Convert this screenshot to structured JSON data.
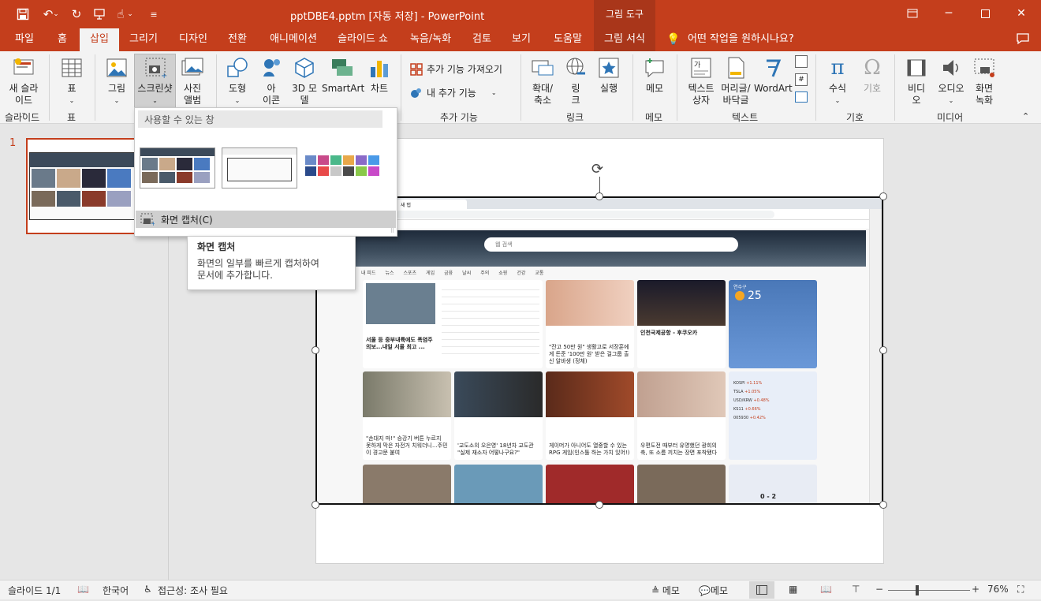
{
  "window": {
    "title": "pptDBE4.pptm [자동 저장]  -  PowerPoint",
    "picture_tools": "그림 도구"
  },
  "tabs": [
    "파일",
    "홈",
    "삽입",
    "그리기",
    "디자인",
    "전환",
    "애니메이션",
    "슬라이드 쇼",
    "녹음/녹화",
    "검토",
    "보기",
    "도움말",
    "그림 서식"
  ],
  "tell_me": "어떤 작업을 원하시나요?",
  "ribbon": {
    "new_slide": "새 슬라\n이드",
    "table": "표",
    "picture": "그림",
    "screenshot": "스크린샷",
    "album": "사진\n앨범",
    "shapes": "도형",
    "icons": "아\n이콘",
    "model3d": "3D 모\n델",
    "smartart": "SmartArt",
    "chart": "차트",
    "get_addins": "추가 기능 가져오기",
    "my_addins": "내 추가 기능",
    "zoom": "확대/\n축소",
    "link": "링\n크",
    "action": "실행",
    "comment": "메모",
    "textbox": "텍스트\n상자",
    "header_footer": "머리글/\n바닥글",
    "wordart": "WordArt",
    "equation": "수식",
    "symbol": "기호",
    "video": "비디\n오",
    "audio": "오디오",
    "screen_rec": "화면\n녹화",
    "groups": {
      "slides": "슬라이드",
      "tables": "표",
      "addins": "추가 기능",
      "links": "링크",
      "comments": "메모",
      "text": "텍스트",
      "symbols": "기호",
      "media": "미디어"
    }
  },
  "dropdown": {
    "header": "사용할 수 있는 창",
    "screen_capture": "화면 캡처(C)"
  },
  "tooltip": {
    "title": "화면 캡처",
    "body": "화면의 일부를 빠르게 캡처하여\n문서에 추가합니다."
  },
  "thumbnail_number": "1",
  "browser": {
    "tab_title": "새 탭",
    "search_placeholder": "웹 검색",
    "weather_temp": "25",
    "weather_location": "연수구",
    "nav": [
      "내 피드",
      "뉴스",
      "스포츠",
      "게임",
      "금융",
      "날씨",
      "주의",
      "쇼핑",
      "건강",
      "교통"
    ],
    "cards": [
      "서울 등 중부내륙에도 폭염주의보...내일 서울 최고 ...",
      "\"잔고 50만 원\" 생활고로 서장훈에게 돈준 '100만 원' 받은 걸그룹 출신 알바생 (정체)",
      "인천국제공항 - 후쿠오카",
      "\"손대지 마!\" 승강기 버튼 누르지 못하게 막은 자전거 치워더니...주민이 경고문 붙여",
      "'교도소의 오은영' 18년차 교도관 \"실제 재소자 어떻나구요?\"",
      "게이머가 아니어도 열중할 수 있는 RPG 게임(인스톨 하는 가치 있어!)",
      "우편도전 때부터 유명했던 광희의 축, 또 소름 끼치는 장면 포착됐다"
    ],
    "stocks": [
      {
        "name": "KOSPI",
        "change": "+1.11%"
      },
      {
        "name": "TSLA",
        "change": "+1.05%"
      },
      {
        "name": "USD/KRW",
        "change": "+0.48%"
      },
      {
        "name": "KS11",
        "change": "+0.66%"
      },
      {
        "name": "005930",
        "change": "+0.42%"
      }
    ],
    "mlb_score": "0 - 2"
  },
  "status": {
    "slide": "슬라이드 1/1",
    "lang": "한국어",
    "access": "접근성: 조사 필요",
    "notes": "메모",
    "comments": "메모",
    "zoom": "76%"
  },
  "colors": {
    "accent": "#c43e1c",
    "accent_dark": "#a9361a",
    "ribbon_bg": "#f3f3f3"
  }
}
